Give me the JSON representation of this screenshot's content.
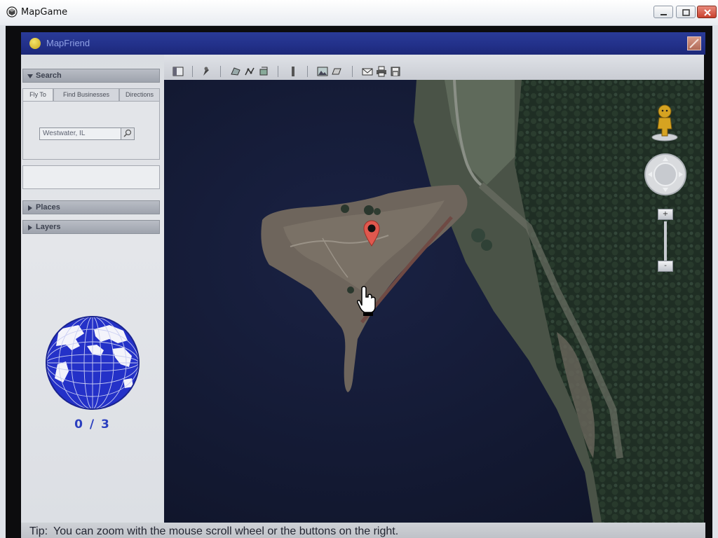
{
  "window": {
    "title": "MapGame",
    "controls": {
      "minimize": "minimize",
      "maximize": "maximize",
      "close": "close"
    }
  },
  "app": {
    "title": "MapFriend",
    "logo_icon": "smiley-icon"
  },
  "sidebar": {
    "search": {
      "header": "Search",
      "tabs": [
        {
          "label": "Fly To",
          "active": true
        },
        {
          "label": "Find Businesses",
          "active": false
        },
        {
          "label": "Directions",
          "active": false
        }
      ],
      "fly_to_value": "Westwater, IL"
    },
    "places_header": "Places",
    "layers_header": "Layers",
    "score": "0 / 3"
  },
  "toolbar": {
    "icons": [
      "sidebar-toggle-icon",
      "placemark-icon",
      "polygon-icon",
      "path-icon",
      "overlay-icon",
      "ruler-icon",
      "photo-icon",
      "tour-icon",
      "email-icon",
      "print-icon",
      "save-icon"
    ]
  },
  "map": {
    "marker": "location-pin",
    "controls": {
      "zoom_in": "+",
      "zoom_out": "-"
    }
  },
  "tip": {
    "label": "Tip:",
    "text": "You can zoom with the mouse scroll wheel or the buttons on the right."
  },
  "colors": {
    "app_header": "#223089",
    "score": "#2b3fbf",
    "globe": "#2431c8",
    "pin": "#e0584e",
    "water": "#141a32"
  }
}
